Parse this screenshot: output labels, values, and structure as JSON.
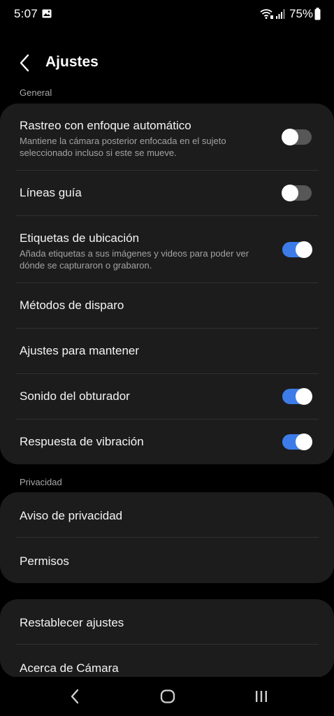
{
  "status_bar": {
    "time": "5:07",
    "battery_percent": "75%",
    "icons": [
      "gallery-icon",
      "wifi-calling-icon",
      "signal-icon",
      "battery-icon"
    ]
  },
  "header": {
    "back_icon": "chevron-left-icon",
    "title": "Ajustes"
  },
  "sections": {
    "general": {
      "label": "General",
      "items": [
        {
          "title": "Rastreo con enfoque automático",
          "subtitle": "Mantiene la cámara posterior enfocada en el sujeto seleccionado incluso si este se mueve.",
          "toggle": "off"
        },
        {
          "title": "Líneas guía",
          "toggle": "off"
        },
        {
          "title": "Etiquetas de ubicación",
          "subtitle": "Añada etiquetas a sus imágenes y videos para poder ver dónde se capturaron o grabaron.",
          "toggle": "on"
        },
        {
          "title": "Métodos de disparo"
        },
        {
          "title": "Ajustes para mantener"
        },
        {
          "title": "Sonido del obturador",
          "toggle": "on"
        },
        {
          "title": "Respuesta de vibración",
          "toggle": "on"
        }
      ]
    },
    "privacy": {
      "label": "Privacidad",
      "items": [
        {
          "title": "Aviso de privacidad"
        },
        {
          "title": "Permisos"
        }
      ]
    },
    "other": {
      "items": [
        {
          "title": "Restablecer ajustes"
        },
        {
          "title": "Acerca de Cámara"
        }
      ]
    }
  },
  "nav_bar": {
    "icons": [
      "nav-back-icon",
      "nav-home-icon",
      "nav-recents-icon"
    ]
  },
  "colors": {
    "background": "#000000",
    "card": "#1c1c1c",
    "accent": "#3d7ce8",
    "toggle_off": "#575757",
    "secondary_text": "#a3a3a3"
  }
}
